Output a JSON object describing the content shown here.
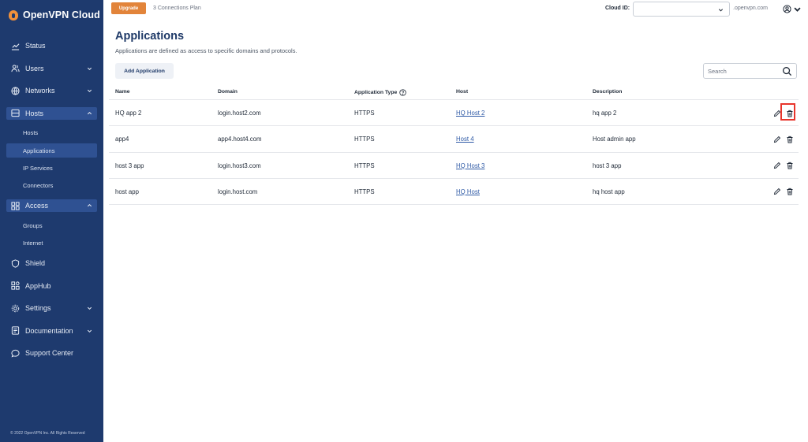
{
  "app": {
    "name": "OpenVPN Cloud",
    "copyright": "© 2022 OpenVPN Inc. All Rights Reserved"
  },
  "sidebar": {
    "items": [
      {
        "label": "Status",
        "icon": "status-chart-icon"
      },
      {
        "label": "Users",
        "icon": "users-icon",
        "expandable": true
      },
      {
        "label": "Networks",
        "icon": "globe-icon",
        "expandable": true
      },
      {
        "label": "Hosts",
        "icon": "server-icon",
        "expandable": true,
        "open": true,
        "children": [
          {
            "label": "Hosts"
          },
          {
            "label": "Applications",
            "active": true
          },
          {
            "label": "IP Services"
          },
          {
            "label": "Connectors"
          }
        ]
      },
      {
        "label": "Access",
        "icon": "grid-icon",
        "expandable": true,
        "open": true,
        "children": [
          {
            "label": "Groups"
          },
          {
            "label": "Internet"
          }
        ]
      },
      {
        "label": "Shield",
        "icon": "shield-icon"
      },
      {
        "label": "AppHub",
        "icon": "apps-icon"
      },
      {
        "label": "Settings",
        "icon": "gear-icon",
        "expandable": true
      },
      {
        "label": "Documentation",
        "icon": "document-icon",
        "expandable": true
      },
      {
        "label": "Support Center",
        "icon": "chat-icon"
      }
    ]
  },
  "topbar": {
    "upgrade_label": "Upgrade",
    "plan": "3 Connections Plan",
    "cloud_id_label": "Cloud ID:",
    "cloud_id_value": "",
    "cloud_domain": ".openvpn.com"
  },
  "main": {
    "title": "Applications",
    "subtitle": "Applications are defined as access to specific domains and protocols.",
    "add_label": "Add Application",
    "search_placeholder": "Search"
  },
  "table": {
    "columns": [
      "Name",
      "Domain",
      "Application Type",
      "Host",
      "Description"
    ],
    "rows": [
      {
        "name": "HQ app 2",
        "domain": "login.host2.com",
        "type": "HTTPS",
        "host": "HQ Host 2",
        "description": "hq app 2"
      },
      {
        "name": "app4",
        "domain": "app4.host4.com",
        "type": "HTTPS",
        "host": "Host 4",
        "description": "Host admin app"
      },
      {
        "name": "host 3 app",
        "domain": "login.host3.com",
        "type": "HTTPS",
        "host": "HQ Host 3",
        "description": "host 3 app"
      },
      {
        "name": "host app",
        "domain": "login.host.com",
        "type": "HTTPS",
        "host": "HQ Host",
        "description": "hq host app"
      }
    ]
  },
  "colors": {
    "sidebar": "#1e3a6e",
    "accent": "#e2843a",
    "title": "#1f3a68",
    "link": "#2f5aa6",
    "highlight": "#e8352b"
  }
}
